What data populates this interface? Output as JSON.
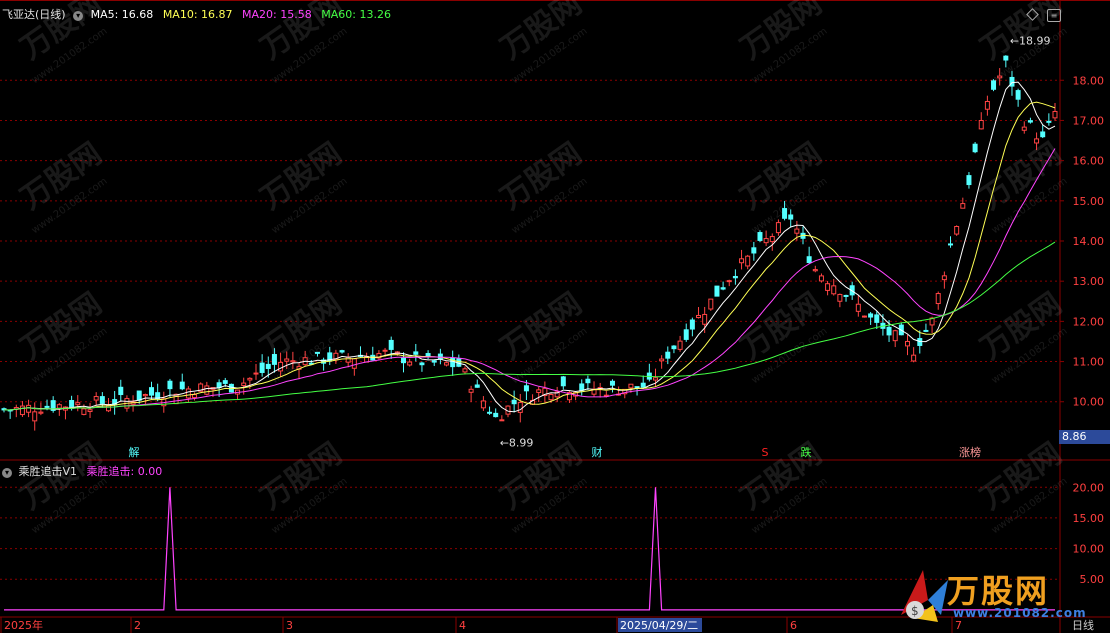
{
  "main_header": {
    "stock_name": "飞亚达(日线)",
    "ma5_label": "MA5: 16.68",
    "ma10_label": "MA10: 16.87",
    "ma20_label": "MA20: 15.58",
    "ma60_label": "MA60: 13.26"
  },
  "indicator_header": {
    "name": "乘胜追击V1",
    "value_label": "乘胜追击: 0.00"
  },
  "colors": {
    "background": "#000000",
    "grid": "#8a0000",
    "up": "#ff4444",
    "down": "#54ffff",
    "ma5": "#ffffff",
    "ma10": "#ffff55",
    "ma20": "#ff44ff",
    "ma60": "#44ff44",
    "axis_text": "#ff4040",
    "indicator": "#ff44ff"
  },
  "chart_data": [
    {
      "type": "candlestick",
      "series": [
        {
          "name": "MA5"
        },
        {
          "name": "MA10"
        },
        {
          "name": "MA20"
        },
        {
          "name": "MA60"
        }
      ],
      "y_ticks": [
        "18.00",
        "17.00",
        "16.00",
        "15.00",
        "14.00",
        "13.00",
        "12.00",
        "11.00",
        "10.00"
      ],
      "ylim": [
        8.6,
        19.4
      ],
      "current_price_label": "8.86",
      "annotations": [
        {
          "text": "18.99",
          "price": 18.99
        },
        {
          "text": "8.99",
          "price": 8.99
        }
      ],
      "event_markers": [
        {
          "text": "解",
          "color": "#54ffff"
        },
        {
          "text": "财",
          "color": "#54ffff"
        },
        {
          "text": "S",
          "color": "#ff2222"
        },
        {
          "text": "跌",
          "color": "#44ff44"
        },
        {
          "text": "涨榜",
          "color": "#ff9999"
        }
      ]
    },
    {
      "type": "line",
      "name": "乘胜追击V1",
      "y_ticks": [
        "20.00",
        "15.00",
        "10.00",
        "5.00"
      ],
      "ylim": [
        -1,
        22
      ],
      "spikes": [
        {
          "x_label": "2",
          "value": 20
        },
        {
          "x_label": "2025/04/29/二",
          "value": 20
        }
      ]
    }
  ],
  "x_axis": {
    "labels": [
      "2025年",
      "2",
      "3",
      "4",
      "2025/04/29/二",
      "6",
      "7"
    ],
    "highlighted_label": "2025/04/29/二",
    "period_button": "日线"
  },
  "watermark": {
    "brand": "万股网",
    "url": "www.201082.com"
  },
  "icons": {
    "header_circle": "circle-chevron-icon",
    "diamond": "diamond-icon",
    "settings": "settings-icon"
  }
}
